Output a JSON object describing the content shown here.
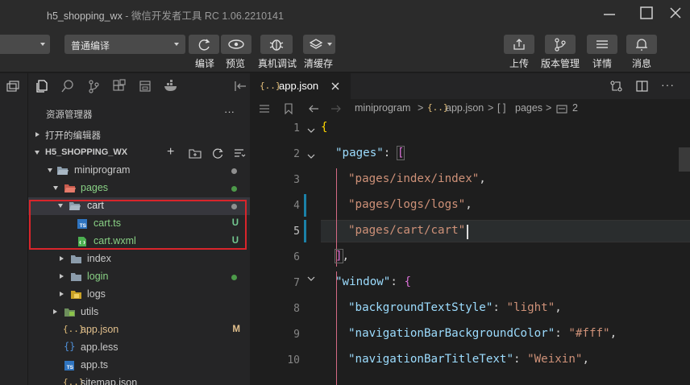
{
  "window": {
    "title": "h5_shopping_wx",
    "subtitle": " - 微信开发者工具 RC 1.06.2210141"
  },
  "toolbar": {
    "compile_mode": "普通编译",
    "labels": {
      "compile": "编译",
      "preview": "预览",
      "real_debug": "真机调试",
      "clear_cache": "清缓存",
      "upload": "上传",
      "version": "版本管理",
      "details": "详情",
      "messages": "消息"
    }
  },
  "sidebar": {
    "title": "资源管理器",
    "more": "···",
    "open_editors": "打开的编辑器",
    "project": "H5_SHOPPING_WX",
    "tree": [
      {
        "label": "miniprogram",
        "type": "folder",
        "status": "dot"
      },
      {
        "label": "pages",
        "type": "folder",
        "status": "dot-green"
      },
      {
        "label": "cart",
        "type": "folder",
        "status": "dot"
      },
      {
        "label": "cart.ts",
        "type": "ts",
        "status": "U"
      },
      {
        "label": "cart.wxml",
        "type": "wxml",
        "status": "U"
      },
      {
        "label": "index",
        "type": "folder",
        "status": ""
      },
      {
        "label": "login",
        "type": "folder",
        "status": "dot-green"
      },
      {
        "label": "logs",
        "type": "folder",
        "status": ""
      },
      {
        "label": "utils",
        "type": "folder",
        "status": ""
      },
      {
        "label": "app.json",
        "type": "json",
        "status": "M"
      },
      {
        "label": "app.less",
        "type": "less",
        "status": ""
      },
      {
        "label": "app.ts",
        "type": "ts",
        "status": ""
      },
      {
        "label": "sitemap.json",
        "type": "json",
        "status": ""
      }
    ]
  },
  "editor": {
    "tab_label": "app.json",
    "tab_icon_text": "{..}",
    "ts_icon_text": "TS",
    "breadcrumb": {
      "folder": "miniprogram",
      "file": "app.json",
      "sep": ">",
      "key": "pages",
      "key_icon": "[ ]",
      "index": "2"
    },
    "line_numbers": [
      "1",
      "2",
      "3",
      "4",
      "5",
      "6",
      "7",
      "8",
      "9",
      "10"
    ],
    "code": {
      "l1": "{",
      "l2_key": "\"pages\"",
      "l2_rest": ": ",
      "l2_br": "[",
      "l3": "\"pages/index/index\"",
      "l4": "\"pages/logs/logs\"",
      "l5": "\"pages/cart/cart\"",
      "l6": "]",
      "l7_key": "\"window\"",
      "l7_br": "{",
      "l8_key": "\"backgroundTextStyle\"",
      "l8_val": "\"light\"",
      "l9_key": "\"navigationBarBackgroundColor\"",
      "l9_val": "\"#fff\"",
      "l10_key": "\"navigationBarTitleText\"",
      "l10_val": "\"Weixin\"",
      "comma": ",",
      "colon": ": "
    }
  },
  "colors": {
    "accent_green": "#89d185",
    "modified": "#e2c08d",
    "highlight_box": "#d9252b"
  }
}
